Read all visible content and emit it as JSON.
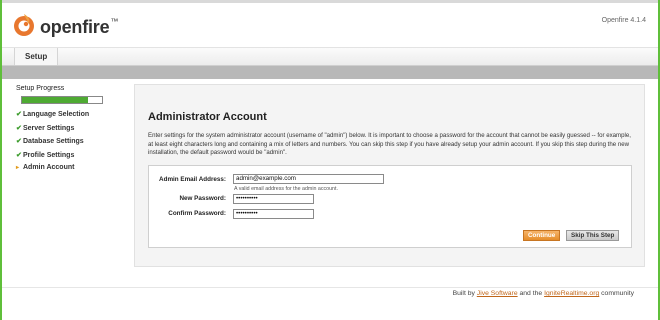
{
  "header": {
    "logo_text": "openfire",
    "version": "Openfire 4.1.4"
  },
  "nav": {
    "tab_label": "Setup"
  },
  "sidebar": {
    "title": "Setup Progress",
    "progress": 0.83,
    "steps": [
      {
        "label": "Language Selection",
        "status": "done"
      },
      {
        "label": "Server Settings",
        "status": "done"
      },
      {
        "label": "Database Settings",
        "status": "done"
      },
      {
        "label": "Profile Settings",
        "status": "done"
      },
      {
        "label": "Admin Account",
        "status": "current"
      }
    ]
  },
  "main": {
    "title": "Administrator Account",
    "description": "Enter settings for the system administrator account (username of \"admin\") below. It is important to choose a password for the account that cannot be easily guessed -- for example, at least eight characters long and containing a mix of letters and numbers. You can skip this step if you have already setup your admin account. If you skip this step during the new installation, the default password would be \"admin\".",
    "form": {
      "email_label": "Admin Email Address:",
      "email_value": "admin@example.com",
      "email_hint": "A valid email address for the admin account.",
      "new_password_label": "New Password:",
      "new_password_value": "••••••••••",
      "confirm_password_label": "Confirm Password:",
      "confirm_password_value": "••••••••••"
    },
    "buttons": {
      "continue": "Continue",
      "skip": "Skip This Step"
    }
  },
  "footer": {
    "prefix": "Built by ",
    "link1": "Jive Software",
    "middle": " and the ",
    "link2": "IgniteRealtime.org",
    "suffix": " community"
  },
  "colors": {
    "brand_orange": "#e8772e",
    "progress_green": "#4eaa33",
    "frame_green": "#5fbf3a"
  }
}
